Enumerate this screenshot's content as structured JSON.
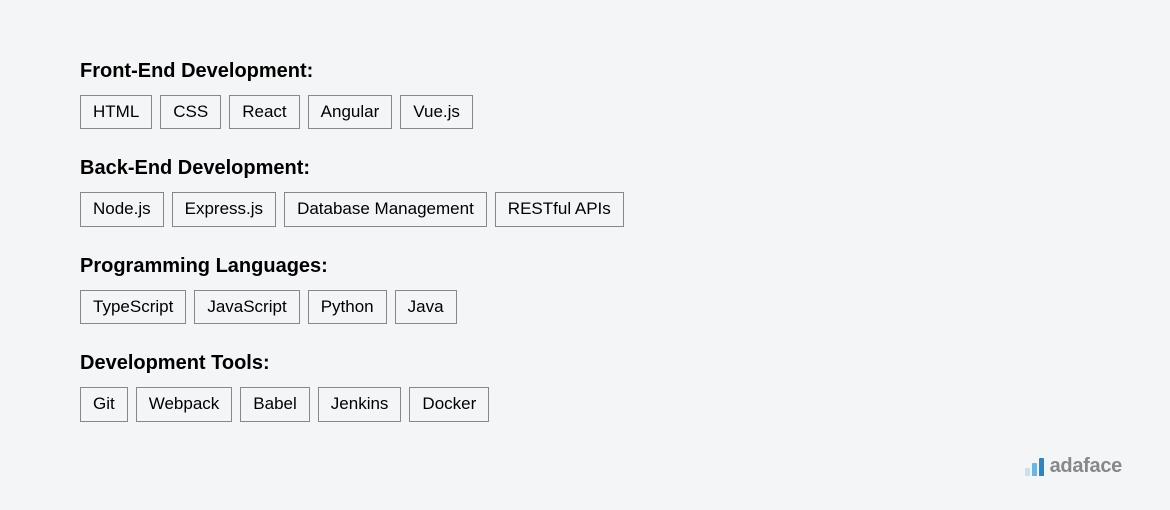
{
  "sections": [
    {
      "heading": "Front-End Development:",
      "tags": [
        "HTML",
        "CSS",
        "React",
        "Angular",
        "Vue.js"
      ]
    },
    {
      "heading": "Back-End Development:",
      "tags": [
        "Node.js",
        "Express.js",
        "Database Management",
        "RESTful APIs"
      ]
    },
    {
      "heading": "Programming Languages:",
      "tags": [
        "TypeScript",
        "JavaScript",
        "Python",
        "Java"
      ]
    },
    {
      "heading": "Development Tools:",
      "tags": [
        "Git",
        "Webpack",
        "Babel",
        "Jenkins",
        "Docker"
      ]
    }
  ],
  "logo": {
    "text": "adaface"
  }
}
